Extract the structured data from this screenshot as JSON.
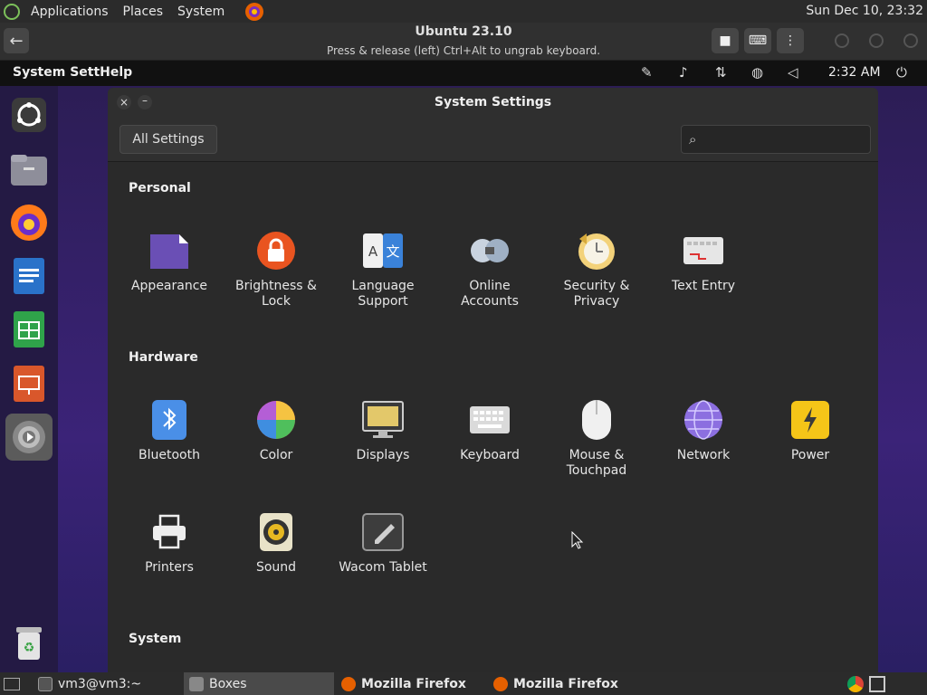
{
  "host_panel": {
    "menus": [
      "Applications",
      "Places",
      "System"
    ],
    "clock": "Sun Dec 10, 23:32"
  },
  "boxes": {
    "title": "Ubuntu 23.10",
    "subtitle": "Press & release (left) Ctrl+Alt to ungrab keyboard."
  },
  "guest_bar": {
    "app_name": "System SettHelp",
    "time": "2:32 AM"
  },
  "window": {
    "title": "System Settings",
    "all_settings_label": "All Settings",
    "search_placeholder": ""
  },
  "sections": {
    "personal": "Personal",
    "hardware": "Hardware",
    "system": "System"
  },
  "personal_items": [
    {
      "label": "Appearance",
      "icon": "appearance-icon"
    },
    {
      "label": "Brightness &\nLock",
      "icon": "lock-icon"
    },
    {
      "label": "Language\nSupport",
      "icon": "language-icon"
    },
    {
      "label": "Online\nAccounts",
      "icon": "online-accounts-icon"
    },
    {
      "label": "Security &\nPrivacy",
      "icon": "security-icon"
    },
    {
      "label": "Text Entry",
      "icon": "keyboard-icon"
    }
  ],
  "hardware_items": [
    {
      "label": "Bluetooth",
      "icon": "bluetooth-icon"
    },
    {
      "label": "Color",
      "icon": "color-icon"
    },
    {
      "label": "Displays",
      "icon": "display-icon"
    },
    {
      "label": "Keyboard",
      "icon": "keyboard-icon"
    },
    {
      "label": "Mouse &\nTouchpad",
      "icon": "mouse-icon"
    },
    {
      "label": "Network",
      "icon": "network-icon"
    },
    {
      "label": "Power",
      "icon": "power-icon"
    },
    {
      "label": "Printers",
      "icon": "printer-icon"
    },
    {
      "label": "Sound",
      "icon": "sound-icon"
    },
    {
      "label": "Wacom Tablet",
      "icon": "tablet-icon"
    }
  ],
  "taskbar": {
    "items": [
      "vm3@vm3:~",
      "Boxes",
      "Mozilla Firefox",
      "Mozilla Firefox"
    ]
  },
  "colors": {
    "accent_orange": "#e95420",
    "dock_bg": "#241a44",
    "window_bg": "#2a2a2a"
  }
}
